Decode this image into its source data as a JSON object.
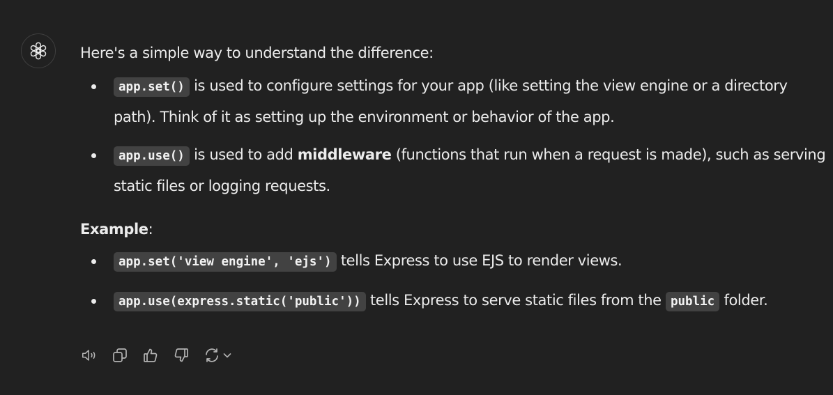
{
  "message": {
    "intro": "Here's a simple way to understand the difference:",
    "points": [
      {
        "code": "app.set()",
        "text": " is used to configure settings for your app (like setting the view engine or a directory path). Think of it as setting up the environment or behavior of the app."
      },
      {
        "code": "app.use()",
        "text_before": " is used to add ",
        "bold": "middleware",
        "text_after": " (functions that run when a request is made), such as serving static files or logging requests."
      }
    ],
    "example_heading": "Example",
    "example_colon": ":",
    "examples": [
      {
        "code": "app.set('view engine', 'ejs')",
        "text": " tells Express to use EJS to render views."
      },
      {
        "code": "app.use(express.static('public'))",
        "text_before": " tells Express to serve static files from the ",
        "inline_code": "public",
        "text_after": " folder."
      }
    ]
  },
  "actions": {
    "icons": [
      "speaker-icon",
      "copy-icon",
      "thumbs-up-icon",
      "thumbs-down-icon",
      "regenerate-icon",
      "chevron-down-icon"
    ]
  },
  "colors": {
    "background": "#212121",
    "text": "#ececec",
    "code_background": "#424242",
    "icon": "#b4b4b4"
  }
}
